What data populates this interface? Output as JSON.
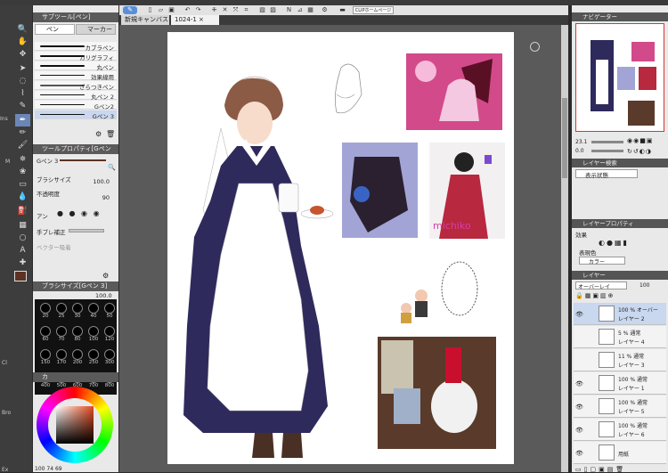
{
  "toolbar": {
    "clip_label": "CLIPホームページ"
  },
  "document_tabs": [
    {
      "label": "新規キャンバス"
    },
    {
      "label": "1024-1"
    }
  ],
  "left_toolbar": {
    "side_labels": [
      "Ins",
      "M",
      "Cl",
      "Bro",
      "Ex"
    ]
  },
  "sub_tool": {
    "header": "サブツール[ペン]",
    "tabs": [
      "ペン",
      "マーカー"
    ],
    "brushes": [
      {
        "label": "カブラペン"
      },
      {
        "label": "カリグラフィ"
      },
      {
        "label": "丸ペン"
      },
      {
        "label": "効果線用"
      },
      {
        "label": "ざらつきペン"
      },
      {
        "label": "丸ペン 2"
      },
      {
        "label": "Gペン2"
      },
      {
        "label": "Gペン 3"
      }
    ]
  },
  "tool_property": {
    "header": "ツールプロパティ[Gペン 3]",
    "preset_label": "Gペン 3",
    "brush_size_label": "ブラシサイズ",
    "brush_size_value": "100.0",
    "opacity_label": "不透明度",
    "opacity_value": "90",
    "antialias_label": "アン",
    "stabilization_label": "手ブレ補正",
    "vector_label": "ベクター吸着"
  },
  "brush_size_panel": {
    "header": "ブラシサイズ[Gペン 3]",
    "value": "100.0",
    "sizes": [
      "20",
      "25",
      "30",
      "40",
      "50",
      "60",
      "70",
      "80",
      "100",
      "120",
      "150",
      "170",
      "200",
      "250",
      "300",
      "400",
      "500",
      "600",
      "700",
      "800"
    ]
  },
  "color_panel": {
    "tab_label": "カ",
    "values": [
      "100",
      "74",
      "69"
    ]
  },
  "navigator": {
    "header": "ナビゲーター",
    "zoom": "23.1",
    "angle": "0.0"
  },
  "layer_search": {
    "header": "レイヤー検索",
    "display_label": "表示状態"
  },
  "layer_property": {
    "header": "レイヤープロパティ",
    "effect_label": "効果",
    "expression_color_label": "表現色",
    "color_mode": "カラー"
  },
  "layer_panel": {
    "header": "レイヤー",
    "blend_mode": "オーバーレイ",
    "opacity": "100",
    "layers": [
      {
        "opacity_mode": "100 % オーバー",
        "name": "レイヤー 2"
      },
      {
        "opacity_mode": "5 % 通常",
        "name": "レイヤー 4"
      },
      {
        "opacity_mode": "11 % 通常",
        "name": "レイヤー 3"
      },
      {
        "opacity_mode": "100 % 通常",
        "name": "レイヤー 1"
      },
      {
        "opacity_mode": "100 % 通常",
        "name": "レイヤー 5"
      },
      {
        "opacity_mode": "100 % 通常",
        "name": "レイヤー 6"
      },
      {
        "opacity_mode": "",
        "name": "用紙"
      }
    ]
  },
  "canvas": {
    "signature": "michiko"
  }
}
